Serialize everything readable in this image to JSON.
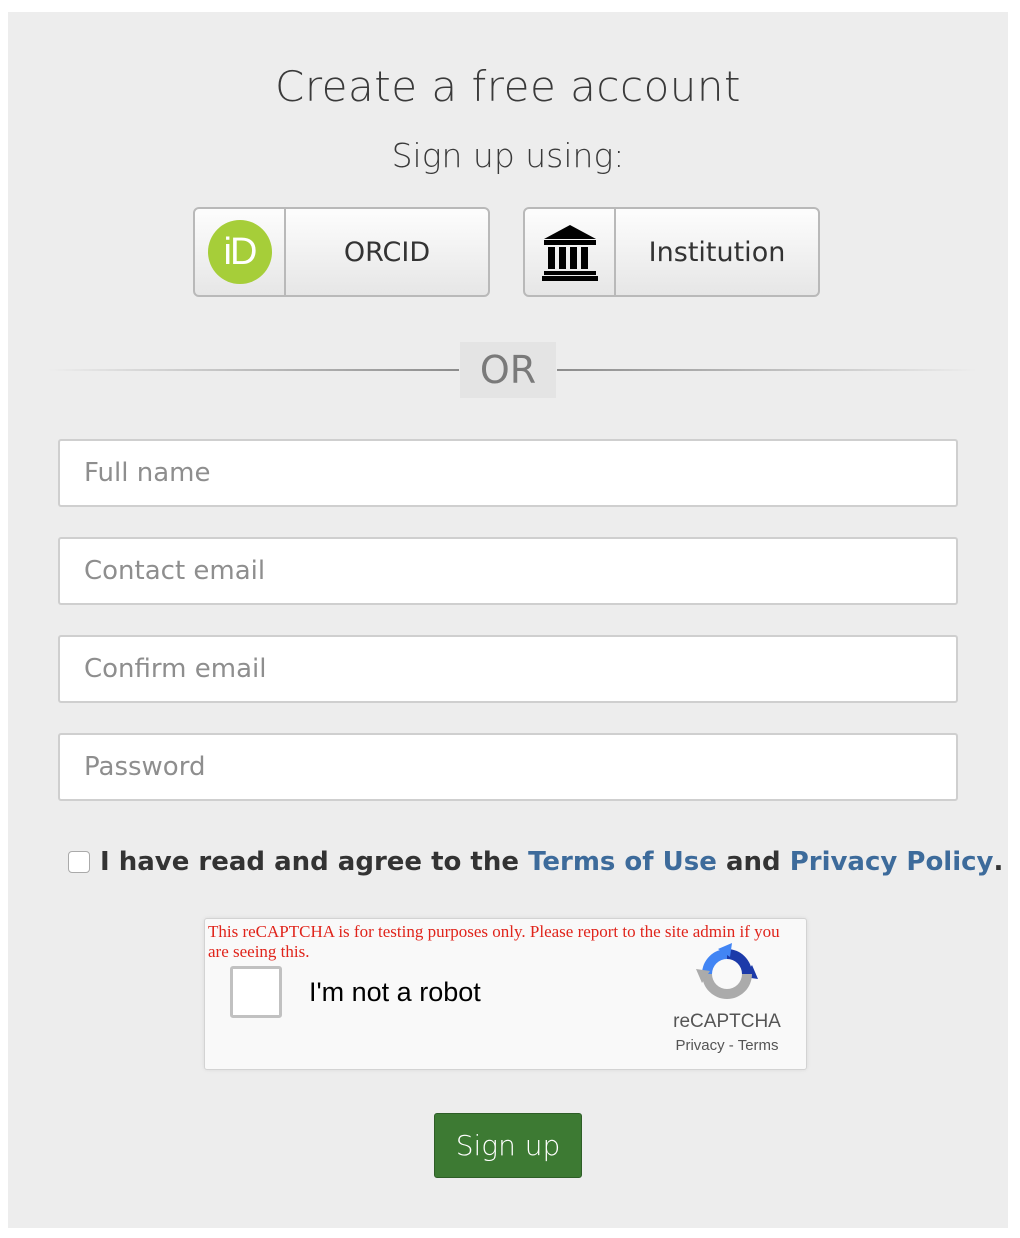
{
  "form": {
    "title": "Create a free account",
    "subtitle": "Sign up using:",
    "or_label": "OR"
  },
  "sso": {
    "orcid": {
      "label": "ORCID",
      "icon": "orcid-id-icon",
      "icon_text": "iD",
      "icon_color": "#a6ce39"
    },
    "institution": {
      "label": "Institution",
      "icon": "institution-building-icon"
    }
  },
  "fields": {
    "full_name": {
      "placeholder": "Full name",
      "value": ""
    },
    "contact_email": {
      "placeholder": "Contact email",
      "value": ""
    },
    "confirm_email": {
      "placeholder": "Confirm email",
      "value": ""
    },
    "password": {
      "placeholder": "Password",
      "value": ""
    }
  },
  "terms": {
    "checked": false,
    "prefix": "I have read and agree to the",
    "terms_link": "Terms of Use",
    "and": "and",
    "privacy_link": "Privacy Policy",
    "suffix": ".",
    "link_color": "#3d6b9b"
  },
  "captcha": {
    "warning": "This reCAPTCHA is for testing purposes only. Please report to the site admin if you are seeing this.",
    "label": "I'm not a robot",
    "brand": "reCAPTCHA",
    "privacy": "Privacy",
    "separator": "-",
    "terms": "Terms",
    "checked": false,
    "warning_color": "#e0241b"
  },
  "submit": {
    "label": "Sign up",
    "color": "#3d7a33"
  }
}
